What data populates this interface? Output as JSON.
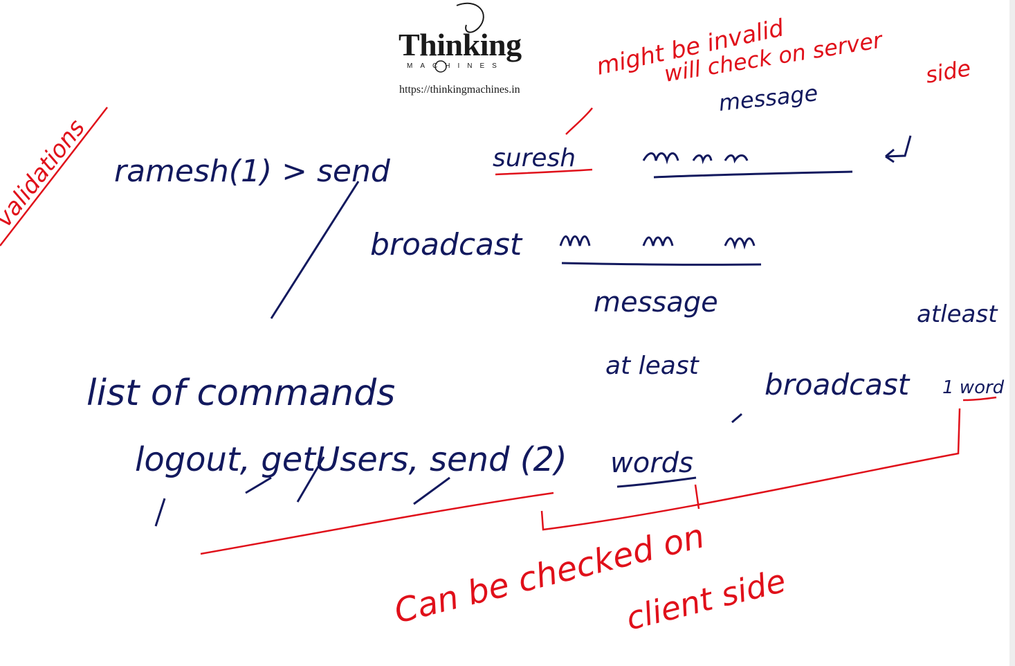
{
  "logo": {
    "word": "Thinking",
    "sub": "MACHINES",
    "url": "https://thinkingmachines.in"
  },
  "ink_colors": {
    "blue": "#12195e",
    "red": "#e0101a"
  },
  "notes": {
    "validations": "validations",
    "might_be_invalid": "might be invalid",
    "will_check_server": "will check on server",
    "side": "side",
    "message_top": "message",
    "cmd_send": "ramesh(1) > send",
    "suresh": "suresh",
    "cmd_broadcast": "broadcast",
    "message_mid": "message",
    "list_of_commands": "list of commands",
    "at_least": "at least",
    "atleast_right": "atleast",
    "commands_line": "logout, getUsers, send (2)",
    "words": "words",
    "broadcast_1": "broadcast",
    "one_word": "1 word",
    "can_be_checked": "Can be checked on",
    "client_side": "client side"
  }
}
